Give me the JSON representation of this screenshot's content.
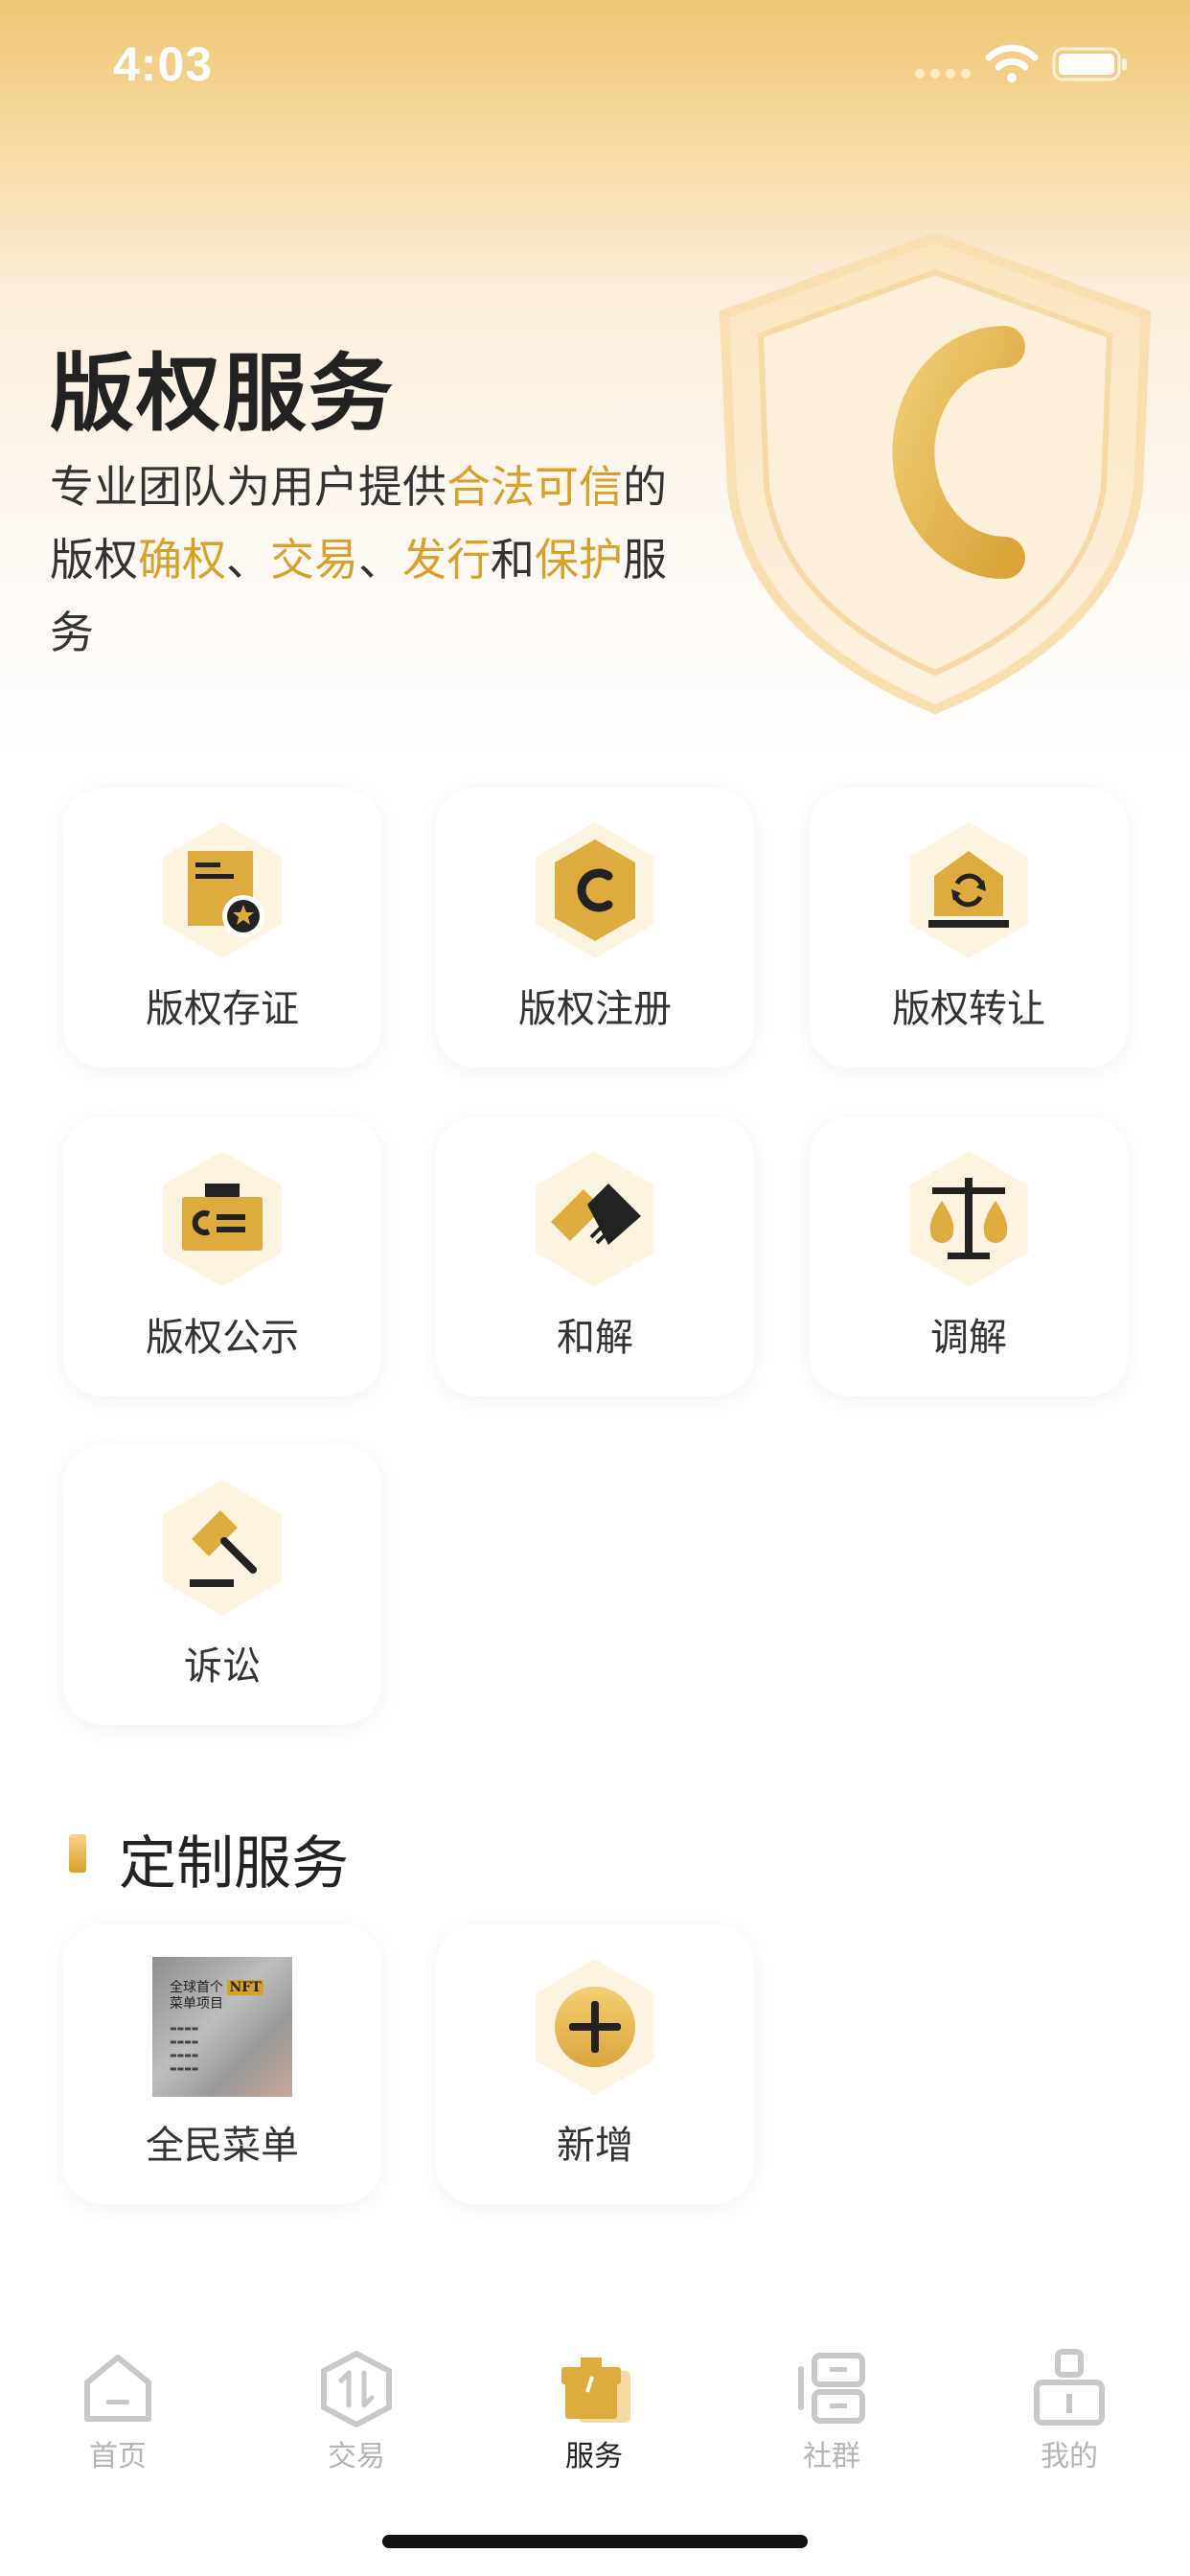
{
  "status_bar": {
    "time": "4:03"
  },
  "hero": {
    "title": "版权服务",
    "desc_parts": {
      "p1": "专业团队为用户提供",
      "h1": "合法可信",
      "p2": "的版权",
      "h2": "确权",
      "p3": "、",
      "h3": "交易",
      "p4": "、",
      "h4": "发行",
      "p5": "和",
      "h5": "保护",
      "p6": "服务"
    }
  },
  "services": [
    {
      "label": "版权存证",
      "icon": "certificate-icon"
    },
    {
      "label": "版权注册",
      "icon": "copyright-icon"
    },
    {
      "label": "版权转让",
      "icon": "transfer-icon"
    },
    {
      "label": "版权公示",
      "icon": "announcement-icon"
    },
    {
      "label": "和解",
      "icon": "handshake-icon"
    },
    {
      "label": "调解",
      "icon": "scale-icon"
    },
    {
      "label": "诉讼",
      "icon": "gavel-icon"
    }
  ],
  "custom_section": {
    "title": "定制服务",
    "items": [
      {
        "label": "全民菜单",
        "thumb_title": "全球首个",
        "thumb_badge": "NFT",
        "thumb_sub": "菜单项目"
      },
      {
        "label": "新增",
        "icon": "add-icon"
      }
    ]
  },
  "tab_bar": {
    "tabs": [
      {
        "label": "首页",
        "icon": "home-icon"
      },
      {
        "label": "交易",
        "icon": "trade-icon"
      },
      {
        "label": "服务",
        "icon": "service-icon",
        "active": true
      },
      {
        "label": "社群",
        "icon": "community-icon"
      },
      {
        "label": "我的",
        "icon": "profile-icon"
      }
    ]
  },
  "colors": {
    "accent": "#d9a02c",
    "hex_bg": "#fdf3e1",
    "text": "#222222",
    "inactive": "#b5b5b5"
  }
}
